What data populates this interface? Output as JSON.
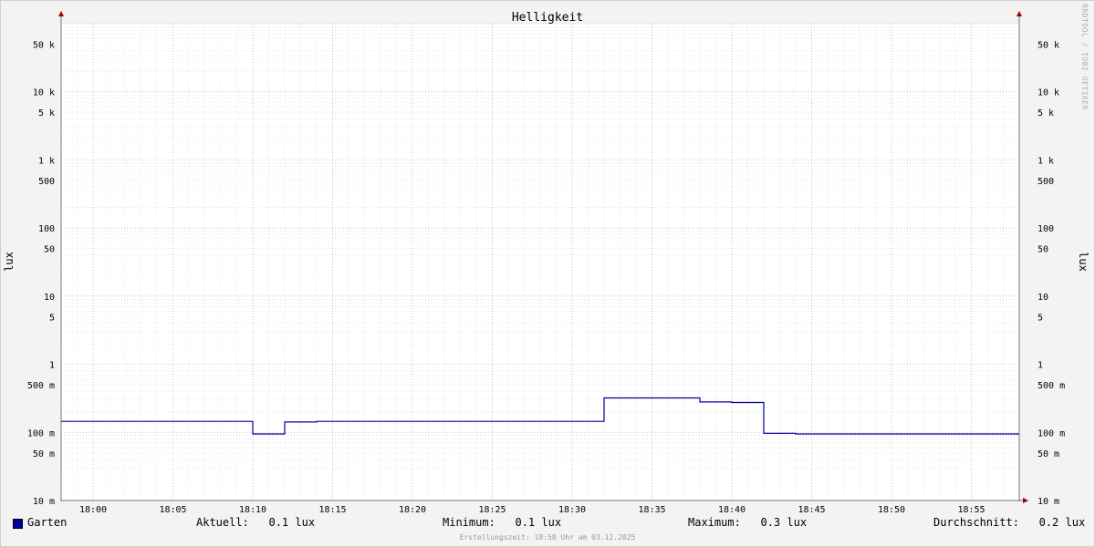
{
  "chart_data": {
    "type": "line",
    "title": "Helligkeit",
    "ylabel": "lux",
    "ylabel_right": "lux",
    "y_scale": "log",
    "ylim": [
      0.01,
      100000
    ],
    "x_range": [
      "17:58",
      "18:58"
    ],
    "x_ticks": [
      "18:00",
      "18:05",
      "18:10",
      "18:15",
      "18:20",
      "18:25",
      "18:30",
      "18:35",
      "18:40",
      "18:45",
      "18:50",
      "18:55"
    ],
    "y_ticks": [
      {
        "value": 50000,
        "label": "50 k"
      },
      {
        "value": 10000,
        "label": "10 k"
      },
      {
        "value": 5000,
        "label": "5 k"
      },
      {
        "value": 1000,
        "label": "1 k"
      },
      {
        "value": 500,
        "label": "500"
      },
      {
        "value": 100,
        "label": "100"
      },
      {
        "value": 50,
        "label": "50"
      },
      {
        "value": 10,
        "label": "10"
      },
      {
        "value": 5,
        "label": "5"
      },
      {
        "value": 1,
        "label": "1"
      },
      {
        "value": 0.5,
        "label": "500 m"
      },
      {
        "value": 0.1,
        "label": "100 m"
      },
      {
        "value": 0.05,
        "label": "50 m"
      },
      {
        "value": 0.01,
        "label": "10 m"
      }
    ],
    "grid": true,
    "series": [
      {
        "name": "Garten",
        "color": "#0000a0",
        "step": true,
        "points": [
          [
            "17:58",
            0.145
          ],
          [
            "18:10",
            0.145
          ],
          [
            "18:10",
            0.095
          ],
          [
            "18:12",
            0.095
          ],
          [
            "18:12",
            0.142
          ],
          [
            "18:14",
            0.142
          ],
          [
            "18:14",
            0.145
          ],
          [
            "18:32",
            0.145
          ],
          [
            "18:32",
            0.32
          ],
          [
            "18:38",
            0.32
          ],
          [
            "18:38",
            0.28
          ],
          [
            "18:40",
            0.28
          ],
          [
            "18:40",
            0.275
          ],
          [
            "18:42",
            0.275
          ],
          [
            "18:42",
            0.097
          ],
          [
            "18:44",
            0.097
          ],
          [
            "18:44",
            0.095
          ],
          [
            "18:58",
            0.095
          ]
        ]
      }
    ]
  },
  "legend": {
    "series_name": "Garten",
    "current": "Aktuell:   0.1 lux",
    "minimum": "Minimum:   0.1 lux",
    "maximum": "Maximum:   0.3 lux",
    "average": "Durchschnitt:   0.2 lux"
  },
  "footer": "Erstellungszeit: 18:58 Uhr am 03.12.2025",
  "watermark": "RRDTOOL / TOBI OETIKER"
}
